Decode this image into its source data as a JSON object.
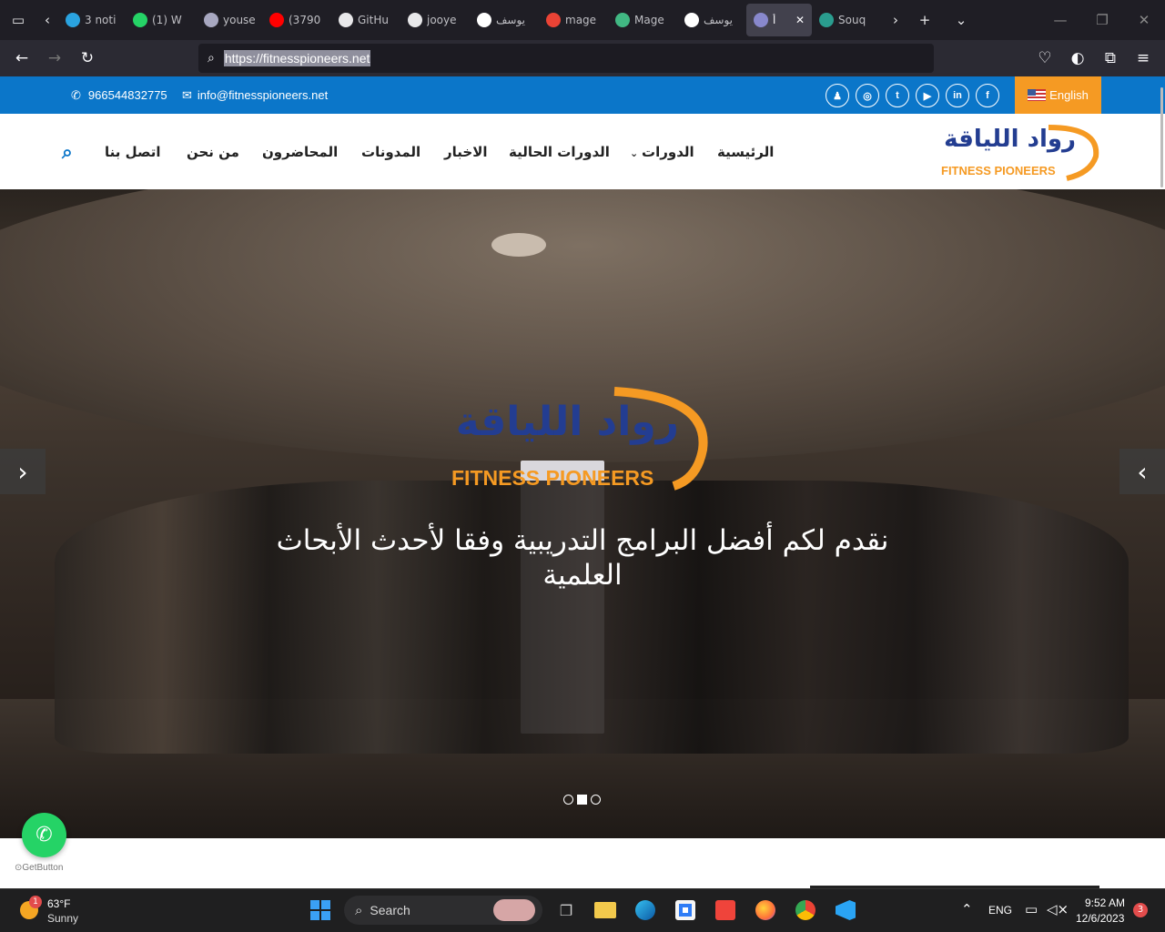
{
  "browser": {
    "tabs": [
      {
        "label": "3 noti",
        "icon": "telegram-icon",
        "color": "#2aa3e0"
      },
      {
        "label": "(1) W",
        "icon": "whatsapp-icon",
        "color": "#25d366"
      },
      {
        "label": "youse",
        "icon": "profile-icon",
        "color": "#a7a7c0"
      },
      {
        "label": "(3790",
        "icon": "youtube-icon",
        "color": "#ff0000"
      },
      {
        "label": "GitHu",
        "icon": "github-icon",
        "color": "#e8e8ea"
      },
      {
        "label": "jooye",
        "icon": "github-icon",
        "color": "#e8e8ea"
      },
      {
        "label": "يوسف",
        "icon": "y-icon",
        "color": "#ffffff"
      },
      {
        "label": "mage",
        "icon": "google-icon",
        "color": "#ea4335"
      },
      {
        "label": "Mage",
        "icon": "vue-icon",
        "color": "#41b883"
      },
      {
        "label": "يوسف",
        "icon": "y-icon",
        "color": "#ffffff"
      },
      {
        "label": "أ",
        "icon": "site-icon",
        "color": "#8888cc"
      },
      {
        "label": "Souq",
        "icon": "souq-icon",
        "color": "#2a9d8f"
      }
    ],
    "url": "https://fitnesspioneers.net"
  },
  "site": {
    "phone": "966544832775",
    "email": "info@fitnesspioneers.net",
    "language": "English",
    "social": [
      "snapchat",
      "instagram",
      "twitter",
      "youtube",
      "linkedin",
      "facebook"
    ],
    "logo_ar": "رواد اللياقة",
    "logo_en": "FITNESS PIONEERS",
    "menu": [
      "الرئيسية",
      "الدورات",
      "الدورات الحالية",
      "الاخبار",
      "المدونات",
      "المحاضرون",
      "من نحن",
      "اتصل بنا"
    ],
    "hero_title": "نقدم لكم أفضل البرامج التدريبية وفقا لأحدث الأبحاث العلمية",
    "slider_dots": 3,
    "active_dot": 2,
    "getbutton": "GetButton"
  },
  "colors": {
    "brand_blue": "#0b76c9",
    "brand_orange": "#f59a23",
    "logo_navy": "#233d91"
  },
  "taskbar": {
    "weather_temp": "63°F",
    "weather_desc": "Sunny",
    "weather_badge": "1",
    "search_label": "Search",
    "lang": "ENG",
    "time": "9:52 AM",
    "date": "12/6/2023",
    "notif_count": "3"
  }
}
